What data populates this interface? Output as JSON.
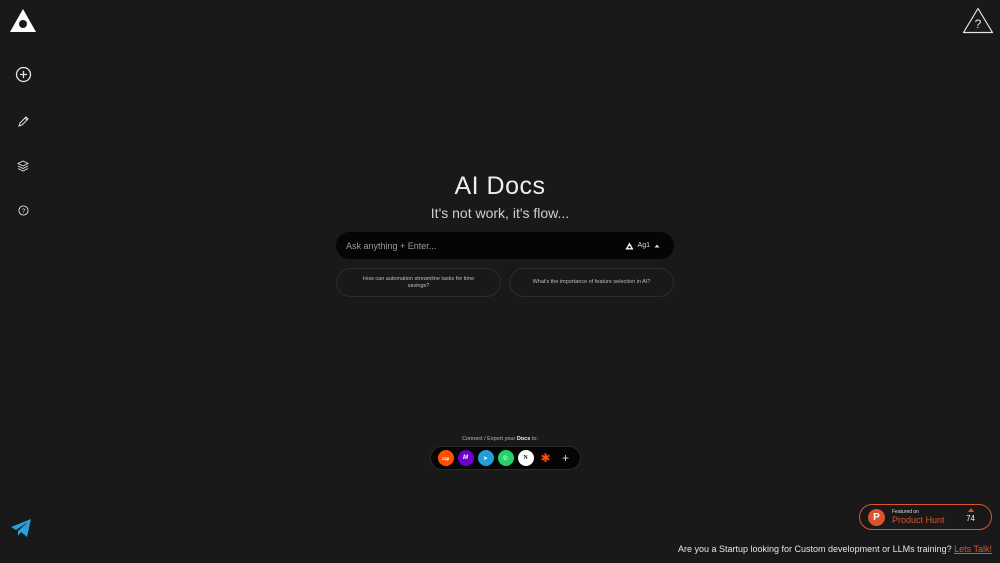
{
  "brand": {
    "logo_icon": "triangle-logo-icon"
  },
  "sidebar": {
    "items": [
      {
        "icon": "plus-circle-icon"
      },
      {
        "icon": "pencil-icon"
      },
      {
        "icon": "layers-icon"
      },
      {
        "icon": "help-circle-icon"
      }
    ],
    "bottom_icon": "telegram-icon"
  },
  "header": {
    "help_icon": "help-triangle-icon",
    "help_label": "?"
  },
  "hero": {
    "title": "AI Docs",
    "subtitle": "It's not work, it's flow..."
  },
  "search": {
    "placeholder": "Ask anything + Enter...",
    "model_label": "Ag1"
  },
  "suggestions": [
    "How can automation streamline tasks for time savings?",
    "What's the importance of feature selection in AI?"
  ],
  "connect": {
    "label_prefix": "Connect / Export your",
    "label_bold": "Docs",
    "label_suffix": "to:",
    "apps": [
      {
        "name": "Zapier",
        "glyph": "zap",
        "color": "#ff4f00"
      },
      {
        "name": "Make",
        "glyph": "M",
        "color": "#6d00cc"
      },
      {
        "name": "Telegram",
        "glyph": "➤",
        "color": "#229ed9"
      },
      {
        "name": "WhatsApp",
        "glyph": "✆",
        "color": "#25d366"
      },
      {
        "name": "Notion",
        "glyph": "N",
        "color": "#ffffff"
      },
      {
        "name": "Zapier asterisk",
        "glyph": "✱",
        "color": "#ff4f00"
      }
    ],
    "more_label": "+"
  },
  "producthunt": {
    "small": "Featured on",
    "big": "Product Hunt",
    "count": "74",
    "accent": "#da552f"
  },
  "footer": {
    "text": "Are you a Startup looking for Custom development or LLMs training?",
    "link": "Lets Talk!"
  }
}
